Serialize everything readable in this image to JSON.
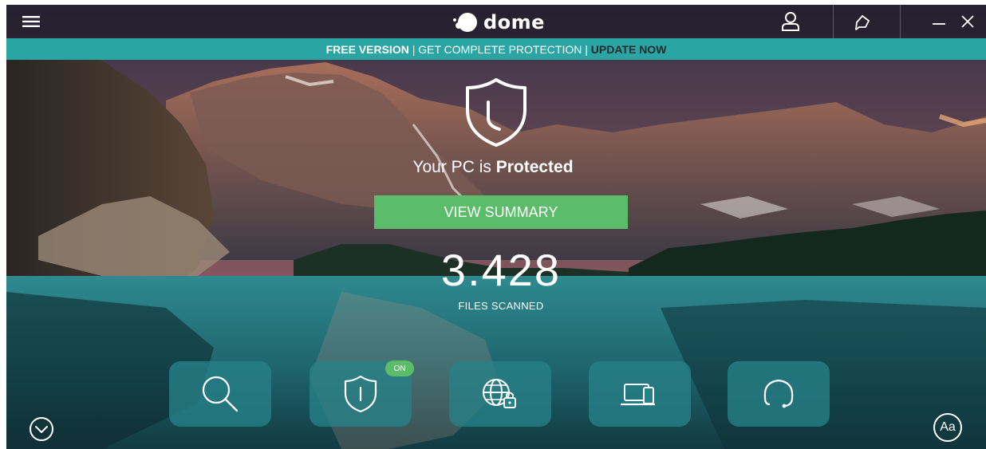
{
  "app": {
    "name": "dome"
  },
  "banner": {
    "free_version": "FREE VERSION",
    "sep1": " | ",
    "get_protection": "GET COMPLETE PROTECTION",
    "sep2": " | ",
    "update_now": "UPDATE NOW"
  },
  "status": {
    "prefix": "Your PC is ",
    "state": "Protected"
  },
  "summary_button": "VIEW SUMMARY",
  "files": {
    "count": "3.428",
    "label": "FILES SCANNED"
  },
  "tiles": [
    {
      "icon": "search-icon"
    },
    {
      "icon": "shield-icon",
      "badge": "ON"
    },
    {
      "icon": "globe-lock-icon"
    },
    {
      "icon": "devices-icon"
    },
    {
      "icon": "headset-icon"
    }
  ],
  "bottom_right_label": "Aa",
  "colors": {
    "banner": "#2aa5a4",
    "summary_button": "#5bbd6a",
    "tile": "#268288",
    "badge_on": "#5bbd6a",
    "update_now": "#1e2a30"
  }
}
